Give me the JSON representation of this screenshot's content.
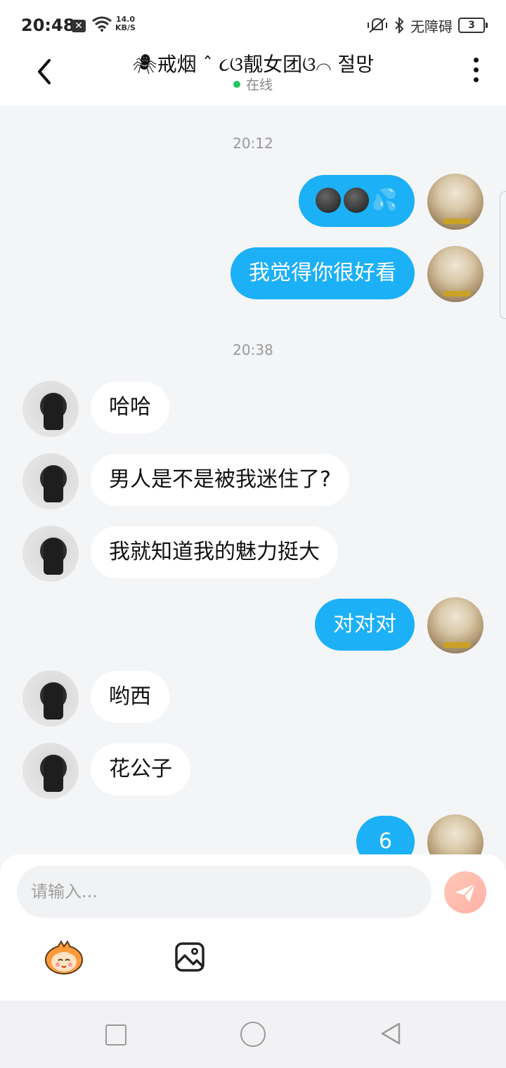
{
  "status_bar": {
    "time": "20:48",
    "net_speed_value": "14.0",
    "net_speed_unit": "KB/S",
    "accessibility": "无障碍",
    "battery": "3"
  },
  "header": {
    "title": "🕷戒烟 ˆ ૮ଓ靓女团ଓ⌒ 절망",
    "status": "在线"
  },
  "messages": [
    {
      "type": "time",
      "text": "20:12"
    },
    {
      "type": "me",
      "text": ""
    },
    {
      "type": "me",
      "text": "我觉得你很好看"
    },
    {
      "type": "time",
      "text": "20:38"
    },
    {
      "type": "them",
      "text": "哈哈"
    },
    {
      "type": "them",
      "text": "男人是不是被我迷住了?"
    },
    {
      "type": "them",
      "text": "我就知道我的魅力挺大"
    },
    {
      "type": "me",
      "text": "对对对"
    },
    {
      "type": "them",
      "text": "哟西"
    },
    {
      "type": "them",
      "text": "花公子"
    },
    {
      "type": "me",
      "text": "6"
    }
  ],
  "input": {
    "placeholder": "请输入..."
  },
  "colors": {
    "accent": "#1cb0f6",
    "online": "#22c55e",
    "send_button": "#ffb8a8"
  }
}
